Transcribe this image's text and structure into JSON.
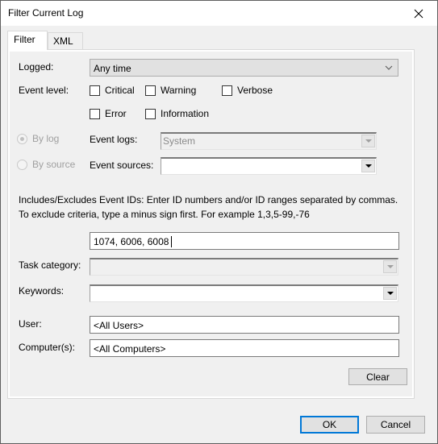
{
  "window": {
    "title": "Filter Current Log",
    "close_label": "✕"
  },
  "tabs": [
    {
      "label": "Filter",
      "active": true
    },
    {
      "label": "XML",
      "active": false
    }
  ],
  "logged": {
    "label": "Logged:",
    "value": "Any time"
  },
  "event_level": {
    "label": "Event level:",
    "options": [
      {
        "label": "Critical",
        "checked": false
      },
      {
        "label": "Warning",
        "checked": false
      },
      {
        "label": "Verbose",
        "checked": false
      },
      {
        "label": "Error",
        "checked": false
      },
      {
        "label": "Information",
        "checked": false
      }
    ]
  },
  "source_mode": {
    "by_log": {
      "label": "By log",
      "selected": true,
      "enabled": false
    },
    "by_source": {
      "label": "By source",
      "selected": false,
      "enabled": false
    }
  },
  "event_logs": {
    "label": "Event logs:",
    "value": "System"
  },
  "event_sources": {
    "label": "Event sources:",
    "value": ""
  },
  "event_ids": {
    "description": "Includes/Excludes Event IDs: Enter ID numbers and/or ID ranges separated by commas. To exclude criteria, type a minus sign first. For example 1,3,5-99,-76",
    "value": "1074, 6006, 6008"
  },
  "task_category": {
    "label": "Task category:",
    "value": ""
  },
  "keywords": {
    "label": "Keywords:",
    "value": ""
  },
  "user": {
    "label": "User:",
    "value": "<All Users>"
  },
  "computers": {
    "label": "Computer(s):",
    "value": "<All Computers>"
  },
  "buttons": {
    "clear": "Clear",
    "ok": "OK",
    "cancel": "Cancel"
  },
  "colors": {
    "accent": "#0078d7"
  }
}
